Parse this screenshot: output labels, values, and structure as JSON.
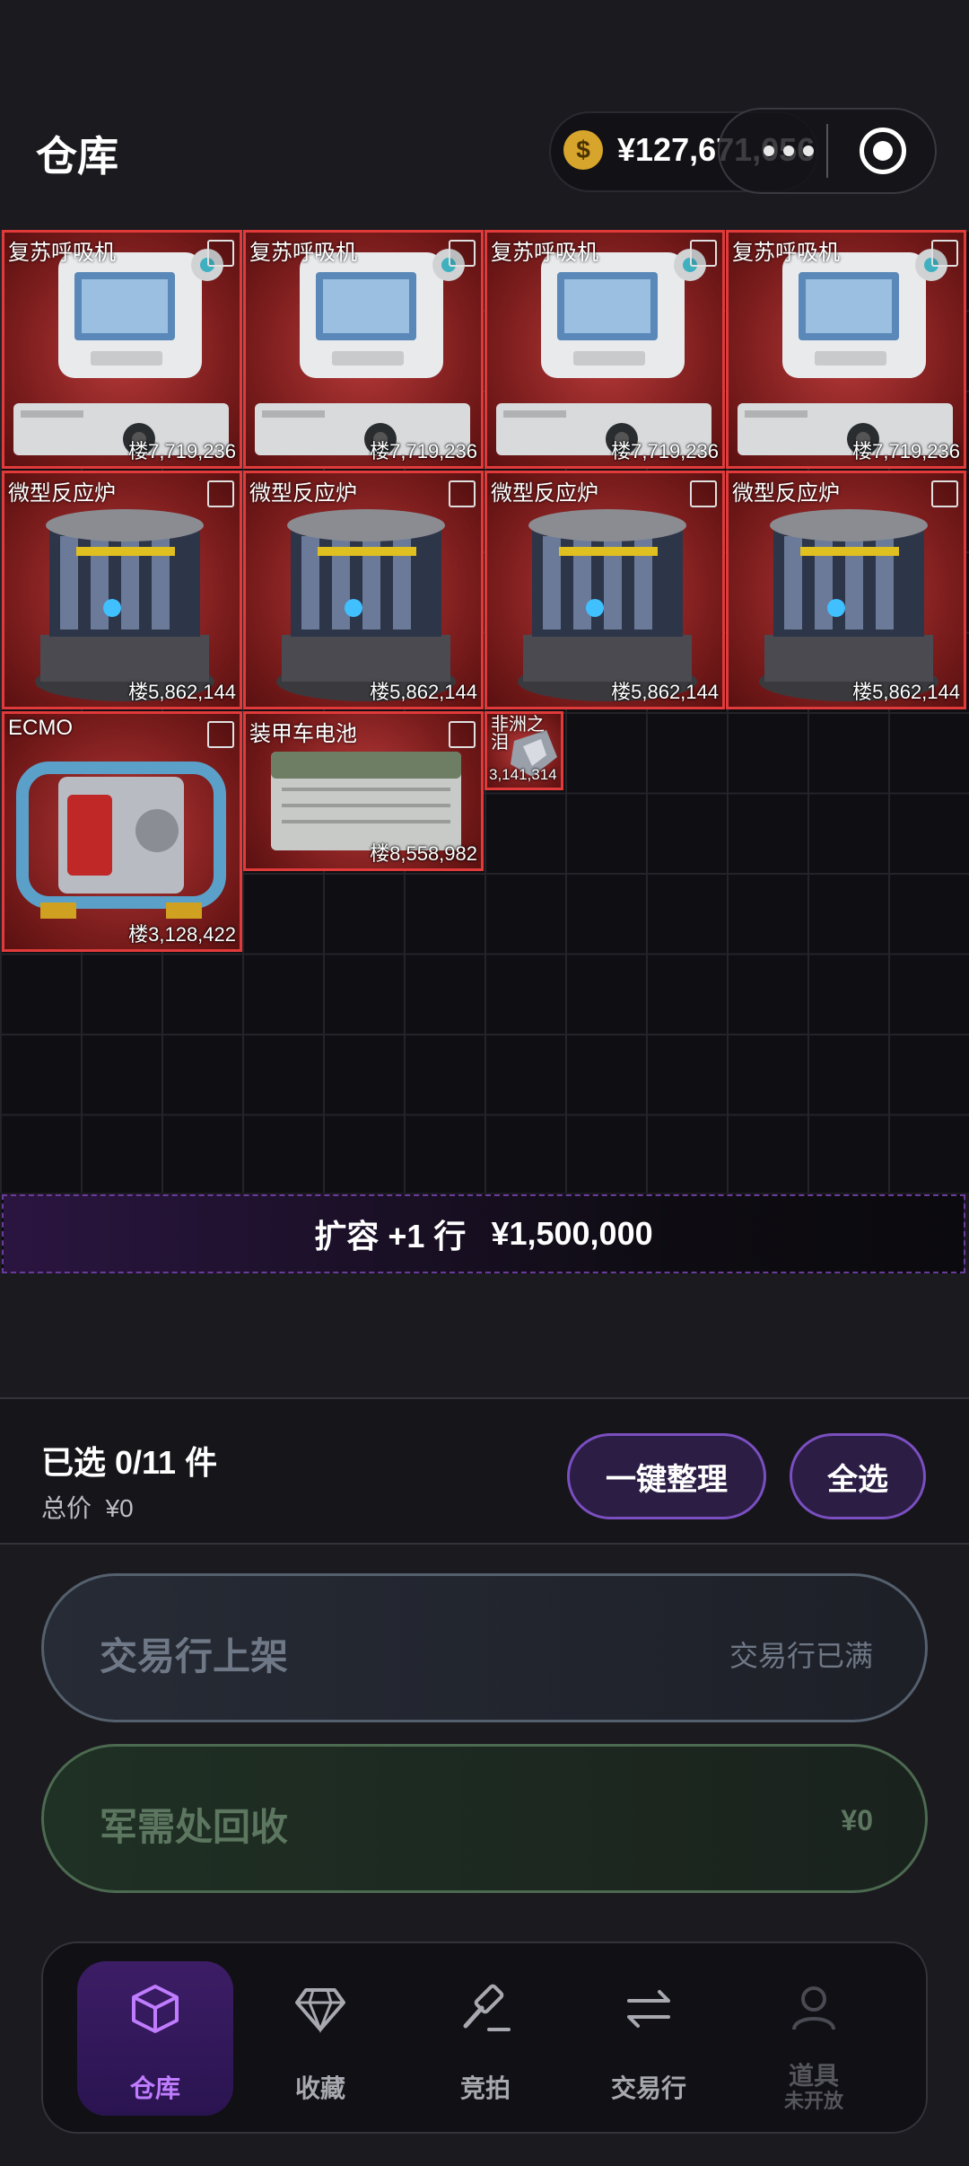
{
  "header": {
    "title": "仓库",
    "balance": "¥127,671,056",
    "currency_symbol": "$"
  },
  "warehouse": {
    "items": [
      {
        "name": "复苏呼吸机",
        "price": "楼7,719,236",
        "kind": "ventilator"
      },
      {
        "name": "复苏呼吸机",
        "price": "楼7,719,236",
        "kind": "ventilator"
      },
      {
        "name": "复苏呼吸机",
        "price": "楼7,719,236",
        "kind": "ventilator"
      },
      {
        "name": "复苏呼吸机",
        "price": "楼7,719,236",
        "kind": "ventilator"
      },
      {
        "name": "微型反应炉",
        "price": "楼5,862,144",
        "kind": "reactor"
      },
      {
        "name": "微型反应炉",
        "price": "楼5,862,144",
        "kind": "reactor"
      },
      {
        "name": "微型反应炉",
        "price": "楼5,862,144",
        "kind": "reactor"
      },
      {
        "name": "微型反应炉",
        "price": "楼5,862,144",
        "kind": "reactor"
      },
      {
        "name": "ECMO",
        "price": "楼3,128,422",
        "kind": "ecmo"
      },
      {
        "name": "装甲车电池",
        "price": "楼8,558,982",
        "kind": "battery"
      },
      {
        "name": "非洲之",
        "name2": "泪",
        "price": "3,141,314",
        "kind": "gem"
      }
    ],
    "expand_label": "扩容 +1 行",
    "expand_price": "¥1,500,000"
  },
  "selection": {
    "count_label": "已选 0/11 件",
    "total_label": "总价",
    "total_value": "¥0",
    "sort_button": "一键整理",
    "select_all_button": "全选"
  },
  "actions": {
    "market_list_label": "交易行上架",
    "market_status": "交易行已满",
    "recycle_label": "军需处回收",
    "recycle_value": "¥0"
  },
  "tabs": [
    {
      "label": "仓库",
      "icon": "box-icon",
      "active": true
    },
    {
      "label": "收藏",
      "icon": "diamond-icon",
      "active": false
    },
    {
      "label": "竞拍",
      "icon": "gavel-icon",
      "active": false
    },
    {
      "label": "交易行",
      "icon": "swap-icon",
      "active": false
    },
    {
      "label": "道具",
      "sub": "未开放",
      "icon": "user-icon",
      "active": false
    }
  ],
  "colors": {
    "accent": "#7a4fc0",
    "item_border": "#e03a3a",
    "coin": "#d7a52b"
  }
}
